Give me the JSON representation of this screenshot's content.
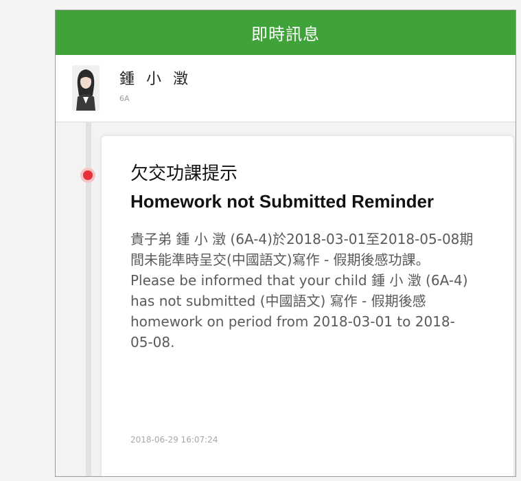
{
  "header": {
    "title": "即時訊息"
  },
  "contact": {
    "name": "鍾 小 澂",
    "class": "6A"
  },
  "message": {
    "title_zh": "欠交功課提示",
    "title_en": "Homework not Submitted Reminder",
    "body_zh": "貴子弟 鍾 小 澂 (6A-4)於2018-03-01至2018-05-08期間未能準時呈交(中國語文)寫作 - 假期後感功課。",
    "body_en": "Please be informed that your child 鍾 小 澂 (6A-4) has not submitted (中國語文) 寫作 - 假期後感 homework on period from 2018-03-01 to 2018-05-08.",
    "timestamp": "2018-06-29 16:07:24"
  },
  "colors": {
    "header_green": "#3fa33a",
    "dot_red": "#e8303a"
  },
  "icons": {
    "avatar": "student-photo"
  }
}
